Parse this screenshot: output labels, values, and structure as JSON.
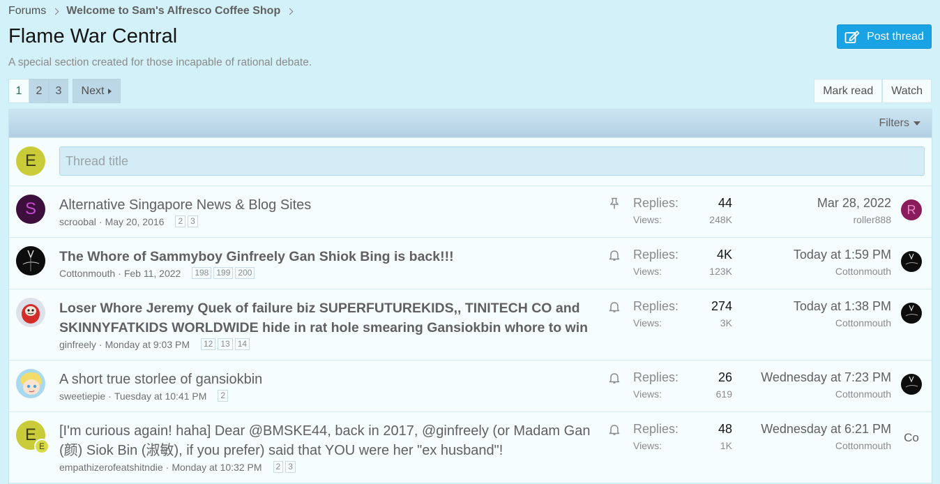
{
  "breadcrumb": {
    "root": "Forums",
    "parent": "Welcome to Sam's Alfresco Coffee Shop"
  },
  "page": {
    "title": "Flame War Central",
    "description": "A special section created for those incapable of rational debate.",
    "post_thread_label": "Post thread"
  },
  "pagination": {
    "pages": [
      "1",
      "2",
      "3"
    ],
    "current": "1",
    "next_label": "Next"
  },
  "actions": {
    "mark_read": "Mark read",
    "watch": "Watch"
  },
  "filters_label": "Filters",
  "new_thread": {
    "avatar_letter": "E",
    "placeholder": "Thread title"
  },
  "labels": {
    "replies": "Replies:",
    "views": "Views:"
  },
  "threads": [
    {
      "avatar_letter": "S",
      "title": "Alternative Singapore News & Blog Sites",
      "author": "scroobal",
      "date": "May 20, 2016",
      "pages": [
        "2",
        "3"
      ],
      "status_icon": "pin-icon",
      "replies": "44",
      "views": "248K",
      "last_date": "Mar 28, 2022",
      "last_user": "roller888",
      "last_avatar_letter": "R"
    },
    {
      "avatar_letter": "",
      "title": "The Whore of Sammyboy Ginfreely Gan Shiok Bing is back!!!",
      "author": "Cottonmouth",
      "date": "Feb 11, 2022",
      "pages": [
        "198",
        "199",
        "200"
      ],
      "status_icon": "bell-icon",
      "replies": "4K",
      "views": "123K",
      "last_date": "Today at 1:59 PM",
      "last_user": "Cottonmouth",
      "last_avatar_letter": ""
    },
    {
      "avatar_letter": "",
      "title_line1": "Loser Whore Jeremy Quek of failure biz SUPERFUTUREKIDS,, TINITECH CO and",
      "title_line2": "SKINNYFATKIDS WORLDWIDE hide in rat hole smearing Gansiokbin whore to win",
      "author": "ginfreely",
      "date": "Monday at 9:03 PM",
      "pages": [
        "12",
        "13",
        "14"
      ],
      "status_icon": "bell-icon",
      "replies": "274",
      "views": "3K",
      "last_date": "Today at 1:38 PM",
      "last_user": "Cottonmouth",
      "last_avatar_letter": ""
    },
    {
      "avatar_letter": "",
      "title": "A short true storlee of gansiokbin",
      "author": "sweetiepie",
      "date": "Tuesday at 10:41 PM",
      "pages": [
        "2"
      ],
      "status_icon": "bell-icon",
      "replies": "26",
      "views": "619",
      "last_date": "Wednesday at 7:23 PM",
      "last_user": "Cottonmouth",
      "last_avatar_letter": ""
    },
    {
      "avatar_letter": "E",
      "badge_letter": "E",
      "title_line1": "[I'm curious again! haha] Dear @BMSKE44, back in 2017, @ginfreely (or Madam Gan",
      "title_line2": "(颜) Siok Bin (淑敏), if you prefer) said that YOU were her \"ex husband\"!",
      "author": "empathizerofeatshitndie",
      "date": "Monday at 10:32 PM",
      "pages": [
        "2",
        "3"
      ],
      "status_icon": "bell-icon",
      "replies": "48",
      "views": "1K",
      "last_date": "Wednesday at 6:21 PM",
      "last_user": "Cottonmouth",
      "last_avatar_letter": "Co"
    }
  ],
  "colors": {
    "accent": "#1aa3e4",
    "background": "#d3f1f8",
    "row_background": "#f5fdff"
  }
}
